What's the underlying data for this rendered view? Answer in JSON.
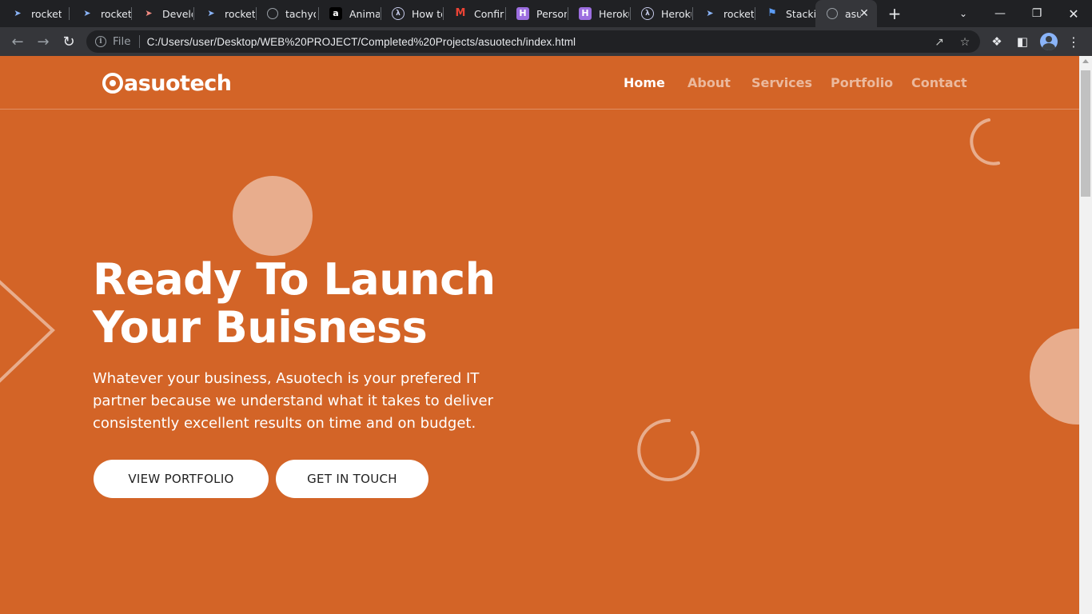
{
  "browser": {
    "tabs": [
      {
        "label": "rocketb",
        "icon": "rocket-icon",
        "color": "#8ab4f8"
      },
      {
        "label": "rocketb",
        "icon": "rocket-icon",
        "color": "#8ab4f8"
      },
      {
        "label": "Develo",
        "icon": "rocket-icon",
        "color": "#f28b82"
      },
      {
        "label": "rocketb",
        "icon": "rocket-icon",
        "color": "#8ab4f8"
      },
      {
        "label": "tachyo",
        "icon": "globe-icon",
        "color": "#9aa0a6"
      },
      {
        "label": "Animat",
        "icon": "amazon-icon",
        "color": "#ffffff"
      },
      {
        "label": "How to",
        "icon": "lambda-icon",
        "color": "#c5cae9"
      },
      {
        "label": "Confirm",
        "icon": "gmail-icon",
        "color": "#ea4335"
      },
      {
        "label": "Person",
        "icon": "heroku-icon",
        "color": "#9c6ee0"
      },
      {
        "label": "Heroku",
        "icon": "heroku-icon",
        "color": "#9c6ee0"
      },
      {
        "label": "Heroku",
        "icon": "lambda-icon",
        "color": "#c5cae9"
      },
      {
        "label": "rocketb",
        "icon": "rocket-icon",
        "color": "#8ab4f8"
      },
      {
        "label": "Stackin",
        "icon": "flag-icon",
        "color": "#5c9cf5"
      },
      {
        "label": "asu",
        "icon": "globe-icon",
        "color": "#9aa0a6"
      }
    ],
    "scheme_label": "File",
    "url": "C:/Users/user/Desktop/WEB%20PROJECT/Completed%20Projects/asuotech/index.html"
  },
  "site": {
    "logo_text": "asuotech",
    "nav": [
      {
        "label": "Home",
        "active": true
      },
      {
        "label": "About",
        "active": false
      },
      {
        "label": "Services",
        "active": false
      },
      {
        "label": "Portfolio",
        "active": false
      },
      {
        "label": "Contact",
        "active": false
      }
    ],
    "hero": {
      "title_line1": "Ready To Launch",
      "title_line2": "Your Buisness",
      "text_line1": "Whatever your business, Asuotech is your prefered IT",
      "text_line2": "partner because we understand what it takes to deliver",
      "text_line3": "consistently excellent results on time and on budget.",
      "btn_portfolio": "VIEW PORTFOLIO",
      "btn_contact": "GET IN TOUCH"
    },
    "colors": {
      "background": "#d36427",
      "accent_soft": "#e8ad8d",
      "text": "#ffffff",
      "button_bg": "#ffffff",
      "button_text": "#222222"
    }
  }
}
